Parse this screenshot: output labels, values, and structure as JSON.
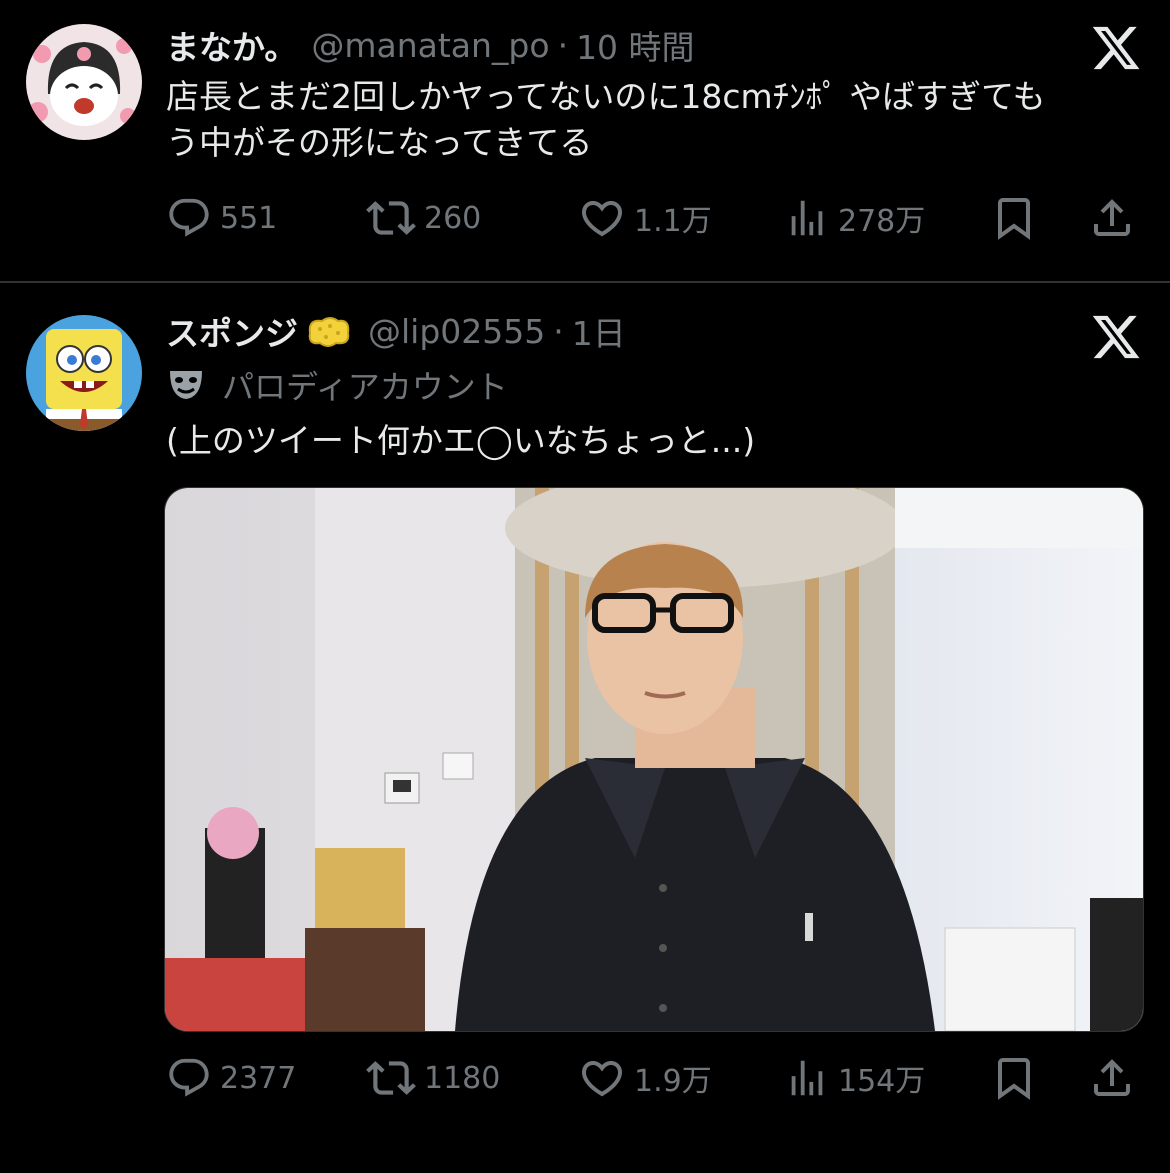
{
  "tweets": [
    {
      "display_name": "まなか。",
      "handle": "@manatan_po",
      "separator": "·",
      "time": "10 時間",
      "text_lines": [
        "店長とまだ2回しかヤってないのに18cmﾁﾝﾎﾟ やばすぎても",
        "う中がその形になってきてる"
      ],
      "actions": {
        "replies": "551",
        "retweets": "260",
        "likes": "1.1万",
        "views": "278万"
      }
    },
    {
      "display_name": "スポンジ",
      "handle": "@lip02555",
      "separator": "·",
      "time": "1日",
      "parody_label": "パロディアカウント",
      "text_lines": [
        "(上のツイート何かエ◯いなちょっと...)"
      ],
      "actions": {
        "replies": "2377",
        "retweets": "1180",
        "likes": "1.9万",
        "views": "154万"
      }
    }
  ],
  "icons": [
    "x-logo-icon",
    "reply-icon",
    "retweet-icon",
    "like-icon",
    "views-icon",
    "bookmark-icon",
    "share-icon",
    "sponge-emoji-icon",
    "parody-mask-icon"
  ],
  "colors": {
    "background": "#000000",
    "text": "#e7e9ea",
    "muted": "#71767b",
    "divider": "#2f3336"
  }
}
